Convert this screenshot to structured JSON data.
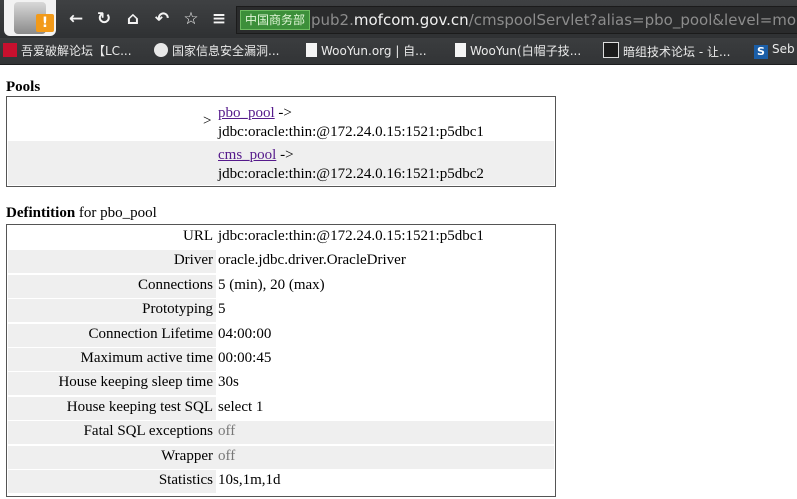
{
  "browser": {
    "address_site": "中国商务部",
    "address_domain_prefix": "pub2.",
    "address_domain": "mofcom.gov.cn",
    "address_path": "/cmspoolServlet?alias=pbo_pool&level=more",
    "bookmarks": [
      "吾爱破解论坛【LC...",
      "国家信息安全漏洞...",
      "WooYun.org | 自...",
      "WooYun(白帽子技...",
      "暗组技术论坛 - 让...",
      "Seb"
    ]
  },
  "page": {
    "pools_heading": "Pools",
    "pools": [
      {
        "name": "pbo_pool",
        "suffix": " ->",
        "url": "jdbc:oracle:thin:@172.24.0.15:1521:p5dbc1"
      },
      {
        "name": "cms_pool",
        "suffix": " ->",
        "url": "jdbc:oracle:thin:@172.24.0.16:1521:p5dbc2"
      }
    ],
    "selected_marker": ">",
    "definition_heading": "Defintition",
    "definition_for": " for pbo_pool",
    "definition": [
      {
        "label": "URL",
        "value": "jdbc:oracle:thin:@172.24.0.15:1521:p5dbc1"
      },
      {
        "label": "Driver",
        "value": "oracle.jdbc.driver.OracleDriver"
      },
      {
        "label": "Connections",
        "value": "5 (min), 20 (max)"
      },
      {
        "label": "Prototyping",
        "value": "5"
      },
      {
        "label": "Connection Lifetime",
        "value": "04:00:00"
      },
      {
        "label": "Maximum active time",
        "value": "00:00:45"
      },
      {
        "label": "House keeping sleep time",
        "value": "30s"
      },
      {
        "label": "House keeping test SQL",
        "value": "select 1"
      },
      {
        "label": "Fatal SQL exceptions",
        "value": "off"
      },
      {
        "label": "Wrapper",
        "value": "off"
      },
      {
        "label": "Statistics",
        "value": "10s,1m,1d"
      }
    ]
  }
}
